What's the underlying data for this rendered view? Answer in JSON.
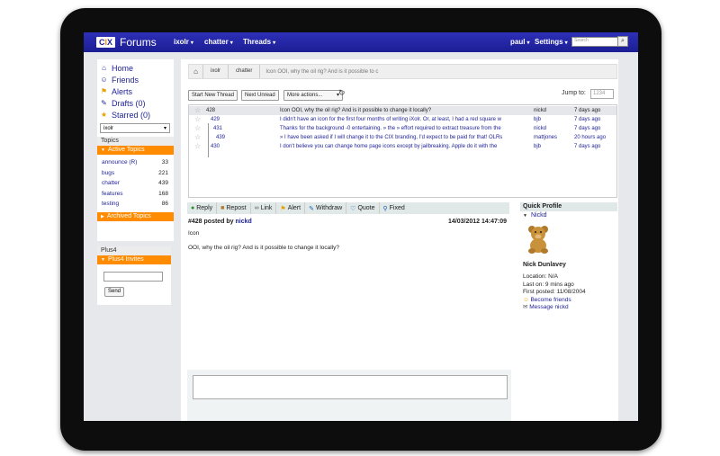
{
  "header": {
    "logo": "CIX",
    "app_title": "Forums",
    "menus": [
      "ixolr",
      "chatter",
      "Threads"
    ],
    "user": "paul",
    "settings": "Settings",
    "search_placeholder": "Search"
  },
  "sidebar": {
    "nav": [
      {
        "label": "Home",
        "icon": "home-icon"
      },
      {
        "label": "Friends",
        "icon": "friends-icon"
      },
      {
        "label": "Alerts",
        "icon": "alert-icon"
      },
      {
        "label": "Drafts (0)",
        "icon": "draft-icon"
      },
      {
        "label": "Starred (0)",
        "icon": "star-icon"
      }
    ],
    "forum_select": "ixolr",
    "topics_title": "Topics",
    "active_topics": "Active Topics",
    "topics": [
      {
        "name": "announce (R)",
        "count": "33"
      },
      {
        "name": "bugs",
        "count": "221"
      },
      {
        "name": "chatter",
        "count": "439"
      },
      {
        "name": "features",
        "count": "168"
      },
      {
        "name": "testing",
        "count": "86"
      }
    ],
    "archived_topics": "Archived Topics",
    "plus4_title": "Plus4",
    "plus4_invites": "Plus4 Invites",
    "send_label": "Send"
  },
  "breadcrumb": {
    "items": [
      "ixolr",
      "chatter"
    ],
    "current": "Icon OOI, why the oil rig? And is it possible to c"
  },
  "toolbar": {
    "start_thread": "Start New Thread",
    "next_unread": "Next Unread",
    "more_actions": "More actions...",
    "jump_label": "Jump to:",
    "jump_placeholder": "1234"
  },
  "threads": [
    {
      "num": "428",
      "subject": "Icon OOI, why the oil rig? And is it possible to change it locally?",
      "author": "nickd",
      "date": "7 days ago"
    },
    {
      "num": "429",
      "subject": "I didn't have an icon for the first four months of writing iXolr. Or, at least, I had a red square w",
      "author": "bjb",
      "date": "7 days ago"
    },
    {
      "num": "431",
      "subject": "Thanks for the background -0 entertaining. » the » effort required to extract treasure from the",
      "author": "nickd",
      "date": "7 days ago"
    },
    {
      "num": "439",
      "subject": "» I have been asked if I will change it to the CIX branding, I'd expect to be paid for that! OLRs",
      "author": "mattjones",
      "date": "20 hours ago"
    },
    {
      "num": "430",
      "subject": "I don't believe you can change home page icons except by jailbreaking. Apple do it with the",
      "author": "bjb",
      "date": "7 days ago"
    }
  ],
  "message_toolbar": [
    {
      "label": "Reply",
      "icon": "reply-icon"
    },
    {
      "label": "Repost",
      "icon": "repost-icon"
    },
    {
      "label": "Link",
      "icon": "link-icon"
    },
    {
      "label": "Alert",
      "icon": "alert-icon"
    },
    {
      "label": "Withdraw",
      "icon": "withdraw-icon"
    },
    {
      "label": "Quote",
      "icon": "quote-icon"
    },
    {
      "label": "Fixed",
      "icon": "fixed-icon"
    }
  ],
  "message": {
    "header_prefix": "#428 posted by",
    "author": "nickd",
    "date": "14/03/2012 14:47:09",
    "subject": "Icon",
    "body": "OOI, why the oil rig?  And is it possible to change it locally?"
  },
  "quick_profile": {
    "title": "Quick Profile",
    "username": "Nickd",
    "full_name": "Nick Dunlavey",
    "location": "Location: N/A",
    "last_on": "Last on: 9 mins ago",
    "first_posted": "First posted: 11/08/2004",
    "become_friends": "Become friends",
    "message_user": "Message nickd"
  }
}
